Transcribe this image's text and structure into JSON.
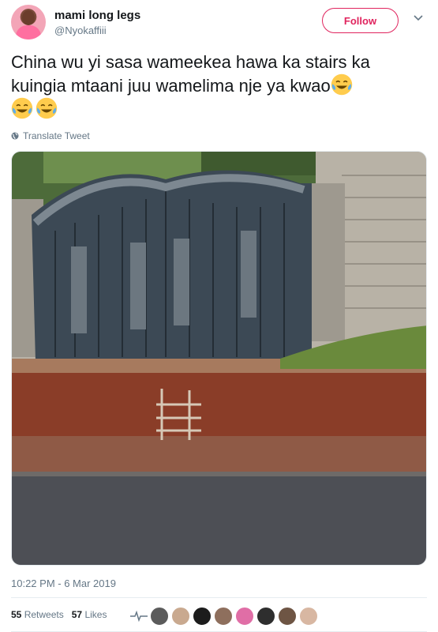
{
  "user": {
    "display_name": "mami long legs",
    "handle": "@Nyokaffiii",
    "follow_label": "Follow"
  },
  "tweet": {
    "text": "China wu yi sasa wameekea hawa ka stairs ka kuingia mtaani juu wamelima nje ya kwao",
    "emoji": "face-with-tears-of-joy",
    "translate_label": "Translate Tweet",
    "timestamp": "10:22 PM - 6 Mar 2019"
  },
  "stats": {
    "retweets_count": "55",
    "retweets_label": "Retweets",
    "likes_count": "57",
    "likes_label": "Likes"
  },
  "colors": {
    "follow_accent": "#e0245e",
    "secondary_text": "#657786"
  }
}
